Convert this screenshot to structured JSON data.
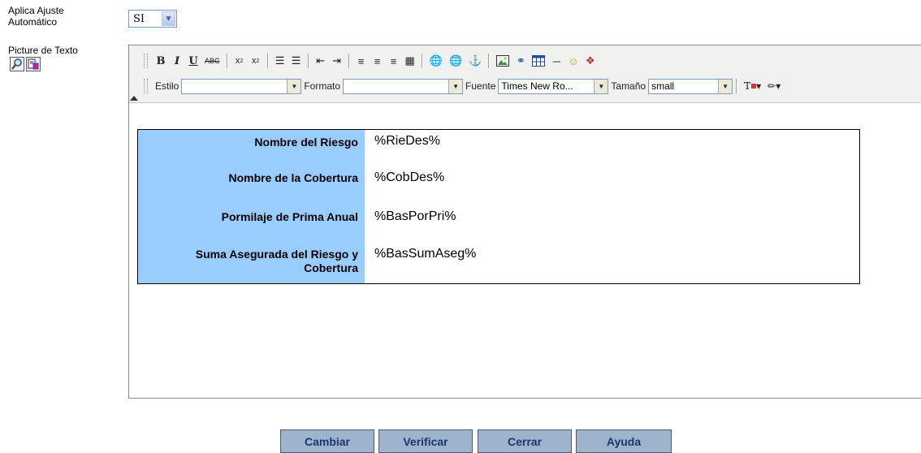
{
  "form": {
    "ajuste_label": "Aplica Ajuste Automático",
    "ajuste_value": "SI",
    "picture_label": "Picture de Texto"
  },
  "toolbar": {
    "row1": [
      "bold-icon",
      "italic-icon",
      "underline-icon",
      "strikethrough-icon",
      "subscript-icon",
      "superscript-icon",
      "ordered-list-icon",
      "unordered-list-icon",
      "outdent-icon",
      "indent-icon",
      "align-left-icon",
      "align-center-icon",
      "align-right-icon",
      "align-justify-icon",
      "link-icon",
      "unlink-icon",
      "anchor-icon",
      "image-icon",
      "flash-icon",
      "table-icon",
      "horizontal-rule-icon",
      "smiley-icon",
      "special-char-icon"
    ],
    "estilo_label": "Estilo",
    "estilo_value": "",
    "formato_label": "Formato",
    "formato_value": "",
    "fuente_label": "Fuente",
    "fuente_value": "Times New Ro...",
    "tamano_label": "Tamaño",
    "tamano_value": "small"
  },
  "table": {
    "rows": [
      {
        "label": "Nombre del Riesgo",
        "value": "%RieDes%"
      },
      {
        "label": "Nombre de la Cobertura",
        "value": "%CobDes%"
      },
      {
        "label": "Pormilaje de Prima Anual",
        "value": "%BasPorPri%"
      },
      {
        "label": "Suma Asegurada del Riesgo y Cobertura",
        "value": "%BasSumAseg%"
      }
    ]
  },
  "buttons": {
    "cambiar": "Cambiar",
    "verificar": "Verificar",
    "cerrar": "Cerrar",
    "ayuda": "Ayuda"
  },
  "colors": {
    "label_column": "#99ccff",
    "button_bg": "#9db4cc",
    "button_text": "#1a3570"
  }
}
